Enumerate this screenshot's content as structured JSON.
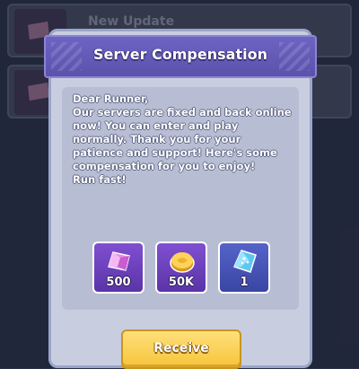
{
  "background_list": [
    {
      "title": "New Update"
    },
    {
      "title": ""
    }
  ],
  "dialog": {
    "title": "Server Compensation",
    "message": "Dear Runner,\nOur servers are fixed and back online now! You can enter and play normally. Thank you for your patience and support! Here's some compensation for you to enjoy!\nRun fast!",
    "rewards": [
      {
        "icon": "pink-gem-icon",
        "quantity": "500"
      },
      {
        "icon": "gold-coin-icon",
        "quantity": "50K"
      },
      {
        "icon": "blue-crystal-icon",
        "quantity": "1"
      }
    ],
    "receive_label": "Receive"
  },
  "colors": {
    "header": "#5b52ad",
    "panel": "#c8cee0",
    "button": "#f6c43a"
  }
}
